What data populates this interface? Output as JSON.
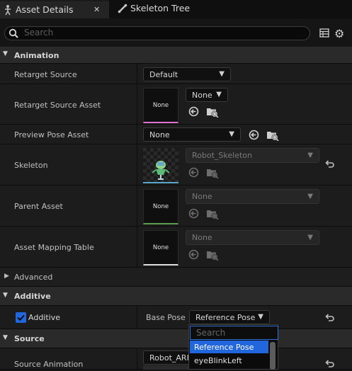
{
  "tabs": [
    {
      "label": "Asset Details",
      "icon": "asset-icon"
    },
    {
      "label": "Skeleton Tree",
      "icon": "bone-icon"
    }
  ],
  "close_glyph": "✕",
  "search": {
    "placeholder": "Search"
  },
  "categories": {
    "animation": "Animation",
    "advanced": "Advanced",
    "additive": "Additive",
    "source": "Source"
  },
  "props": {
    "retarget_source": {
      "label": "Retarget Source",
      "value": "Default"
    },
    "retarget_source_asset": {
      "label": "Retarget Source Asset",
      "thumb": "None",
      "value": "None"
    },
    "preview_pose_asset": {
      "label": "Preview Pose Asset",
      "value": "None"
    },
    "skeleton": {
      "label": "Skeleton",
      "value": "Robot_Skeleton"
    },
    "parent_asset": {
      "label": "Parent Asset",
      "thumb": "None",
      "value": "None"
    },
    "asset_mapping_table": {
      "label": "Asset Mapping Table",
      "thumb": "None",
      "value": "None"
    },
    "additive": {
      "label": "Additive",
      "checked": true,
      "base_pose_label": "Base Pose",
      "base_pose_value": "Reference Pose"
    },
    "source_animation": {
      "label": "Source Animation",
      "value": "Robot_ARKi"
    }
  },
  "dropdown": {
    "search_placeholder": "Search",
    "items": [
      "Reference Pose",
      "eyeBlinkLeft"
    ],
    "selected": "Reference Pose"
  },
  "colors": {
    "accent": "#2266dd",
    "panel": "#1c1c1c",
    "category": "#2a2a2a",
    "thumb_pink": "#e070d0",
    "thumb_cyan": "#57a6c8",
    "thumb_green": "#5d9b50",
    "thumb_white": "#e0e0e0"
  }
}
